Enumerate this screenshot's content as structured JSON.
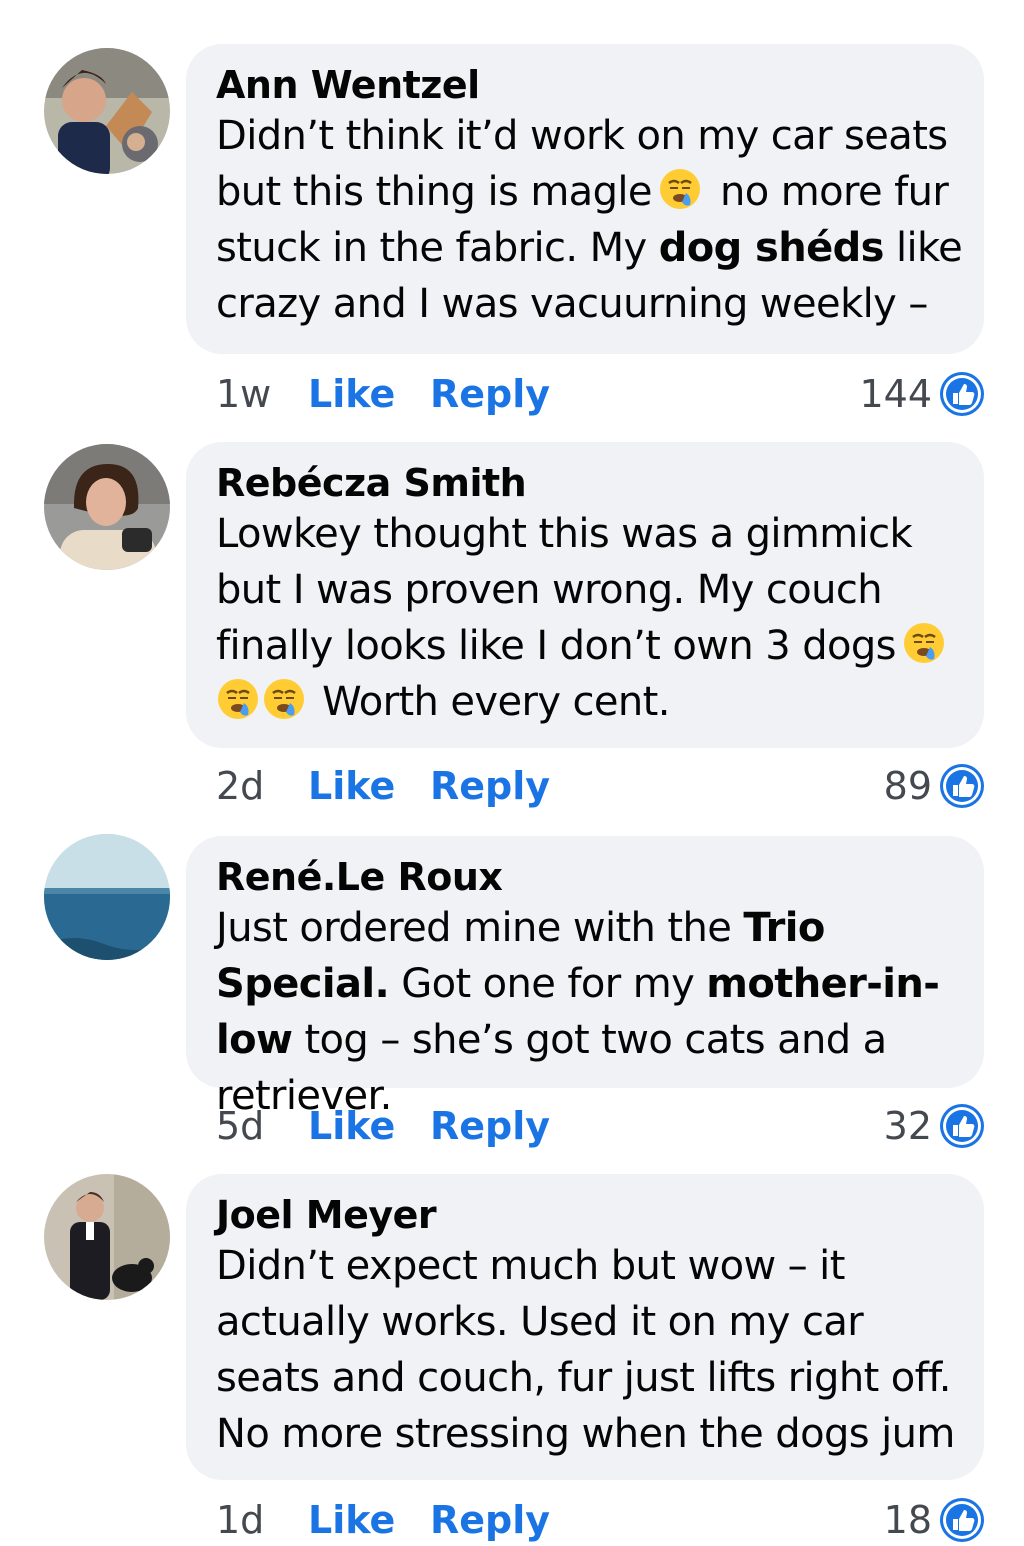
{
  "colors": {
    "bubble": "#f0f2f5",
    "accent": "#1b74e4",
    "meta": "#444950"
  },
  "icons": {
    "reaction": "like-thumbs-up-icon",
    "emoji": "grimacing-tear-emoji"
  },
  "comments": [
    {
      "author": "Ann Wentzel",
      "text_1": "Didn’t think it’d work on my car seats but this thing is magle",
      "text_2": " no more fur stuck in the fabric. My ",
      "bold_1": "dog shéds",
      "text_3": " like crazy and I was vacuurning weekly  –",
      "time": "1w",
      "like": "Like",
      "reply": "Reply",
      "count": "144"
    },
    {
      "author": "Rebécza Smith",
      "text_1": "Lowkey thought this was a gimmick but I was proven wrong. My couch finally looks like I don’t own 3 dogs",
      "text_2": " Worth every cent.",
      "time": "2d",
      "like": "Like",
      "reply": "Reply",
      "count": "89"
    },
    {
      "author": "René.Le Roux",
      "text_1": "Just ordered mine with the ",
      "bold_1": "Trio Special.",
      "text_2": " Got one for my ",
      "bold_2": "mother-in-low",
      "text_3": " tog – she’s got two cats and a retriever.",
      "time": "5d",
      "like": "Like",
      "reply": "Reply",
      "count": "32"
    },
    {
      "author": "Joel Meyer",
      "text_1": "Didn’t expect much but wow – it actually works. Used it on my car seats and couch, fur just lifts right off. No more stressing when the dogs jum",
      "time": "1d",
      "like": "Like",
      "reply": "Reply",
      "count": "18"
    }
  ]
}
